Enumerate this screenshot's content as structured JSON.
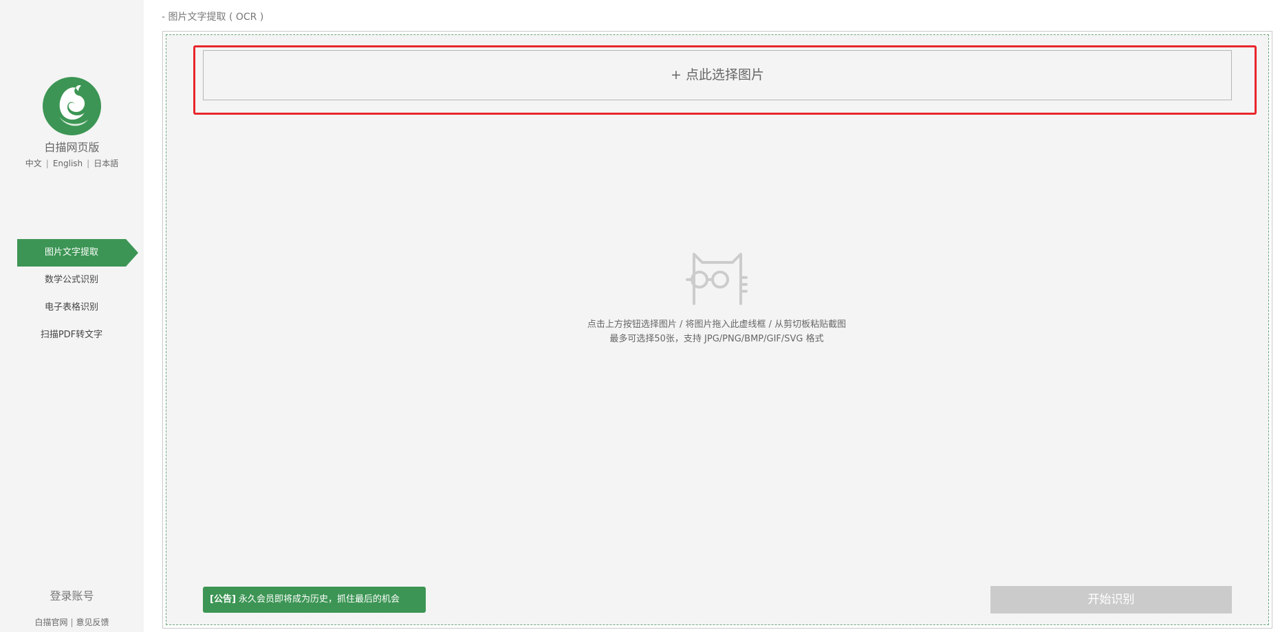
{
  "sidebar": {
    "brand": "白描网页版",
    "languages": [
      "中文",
      "English",
      "日本語"
    ],
    "nav_items": [
      {
        "label": "图片文字提取",
        "active": true
      },
      {
        "label": "数学公式识别",
        "active": false
      },
      {
        "label": "电子表格识别",
        "active": false
      },
      {
        "label": "扫描PDF转文字",
        "active": false
      }
    ],
    "login_label": "登录账号",
    "footer_links": [
      "白描官网",
      "意见反馈"
    ]
  },
  "main": {
    "page_title": "- 图片文字提取 ( OCR )",
    "select_button_label": "+ 点此选择图片",
    "hint_line1": "点击上方按钮选择图片 / 将图片拖入此虚线框 / 从剪切板粘贴截图",
    "hint_line2": "最多可选择50张，支持 JPG/PNG/BMP/GIF/SVG 格式",
    "notice_tag": "[公告]",
    "notice_text": " 永久会员即将成为历史，抓住最后的机会",
    "start_button_label": "开始识别"
  },
  "colors": {
    "brand_green": "#3c9554",
    "highlight_red": "#e8262b",
    "disabled_gray": "#cbcbcb"
  },
  "icons": {
    "logo": "baimiao-squirrel-logo",
    "empty_state": "cat-with-glasses-icon"
  }
}
